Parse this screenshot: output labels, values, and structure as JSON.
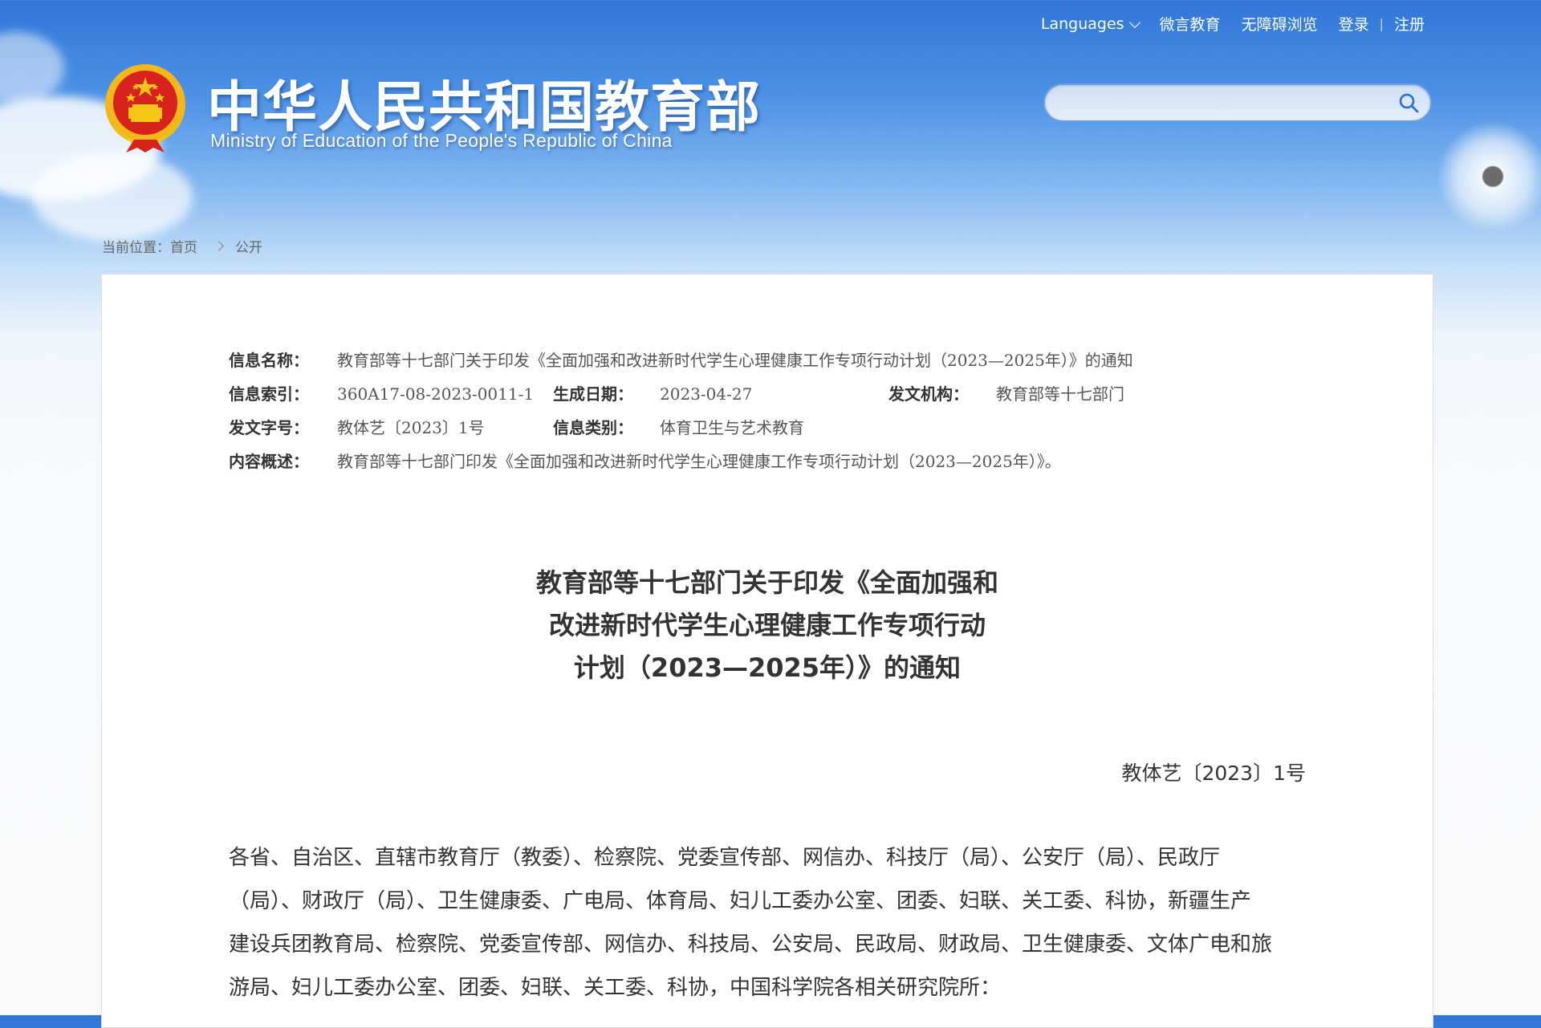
{
  "header": {
    "languages_label": "Languages",
    "weiyan_label": "微言教育",
    "accessible_label": "无障碍浏览",
    "login_label": "登录",
    "divider": "|",
    "register_label": "注册",
    "site_title_cn": "中华人民共和国教育部",
    "site_title_en": "Ministry of Education of the People's Republic of China",
    "search_placeholder": ""
  },
  "breadcrumb": {
    "current_label": "当前位置：",
    "home": "首页",
    "section": "公开"
  },
  "info": {
    "name_label": "信息名称：",
    "name_value": "教育部等十七部门关于印发《全面加强和改进新时代学生心理健康工作专项行动计划（2023—2025年）》的通知",
    "index_label": "信息索引：",
    "index_value": "360A17-08-2023-0011-1",
    "date_label": "生成日期：",
    "date_value": "2023-04-27",
    "org_label": "发文机构：",
    "org_value": "教育部等十七部门",
    "docno_label": "发文字号：",
    "docno_value": "教体艺〔2023〕1号",
    "category_label": "信息类别：",
    "category_value": "体育卫生与艺术教育",
    "summary_label": "内容概述：",
    "summary_value": "教育部等十七部门印发《全面加强和改进新时代学生心理健康工作专项行动计划（2023—2025年）》。"
  },
  "document": {
    "title_lines": [
      "教育部等十七部门关于印发《全面加强和",
      "改进新时代学生心理健康工作专项行动",
      "计划（2023—2025年）》的通知"
    ],
    "doc_number": "教体艺〔2023〕1号",
    "body_lines": [
      "各省、自治区、直辖市教育厅（教委）、检察院、党委宣传部、网信办、科技厅（局）、公安厅（局）、民政厅",
      "（局）、财政厅（局）、卫生健康委、广电局、体育局、妇儿工委办公室、团委、妇联、关工委、科协，新疆生产",
      "建设兵团教育局、检察院、党委宣传部、网信办、科技局、公安局、民政局、财政局、卫生健康委、文体广电和旅",
      "游局、妇儿工委办公室、团委、妇联、关工委、科协，中国科学院各相关研究院所："
    ]
  },
  "colors": {
    "header_blue": "#2f76d8",
    "emblem_red": "#d8231c",
    "emblem_gold": "#f5c518"
  }
}
